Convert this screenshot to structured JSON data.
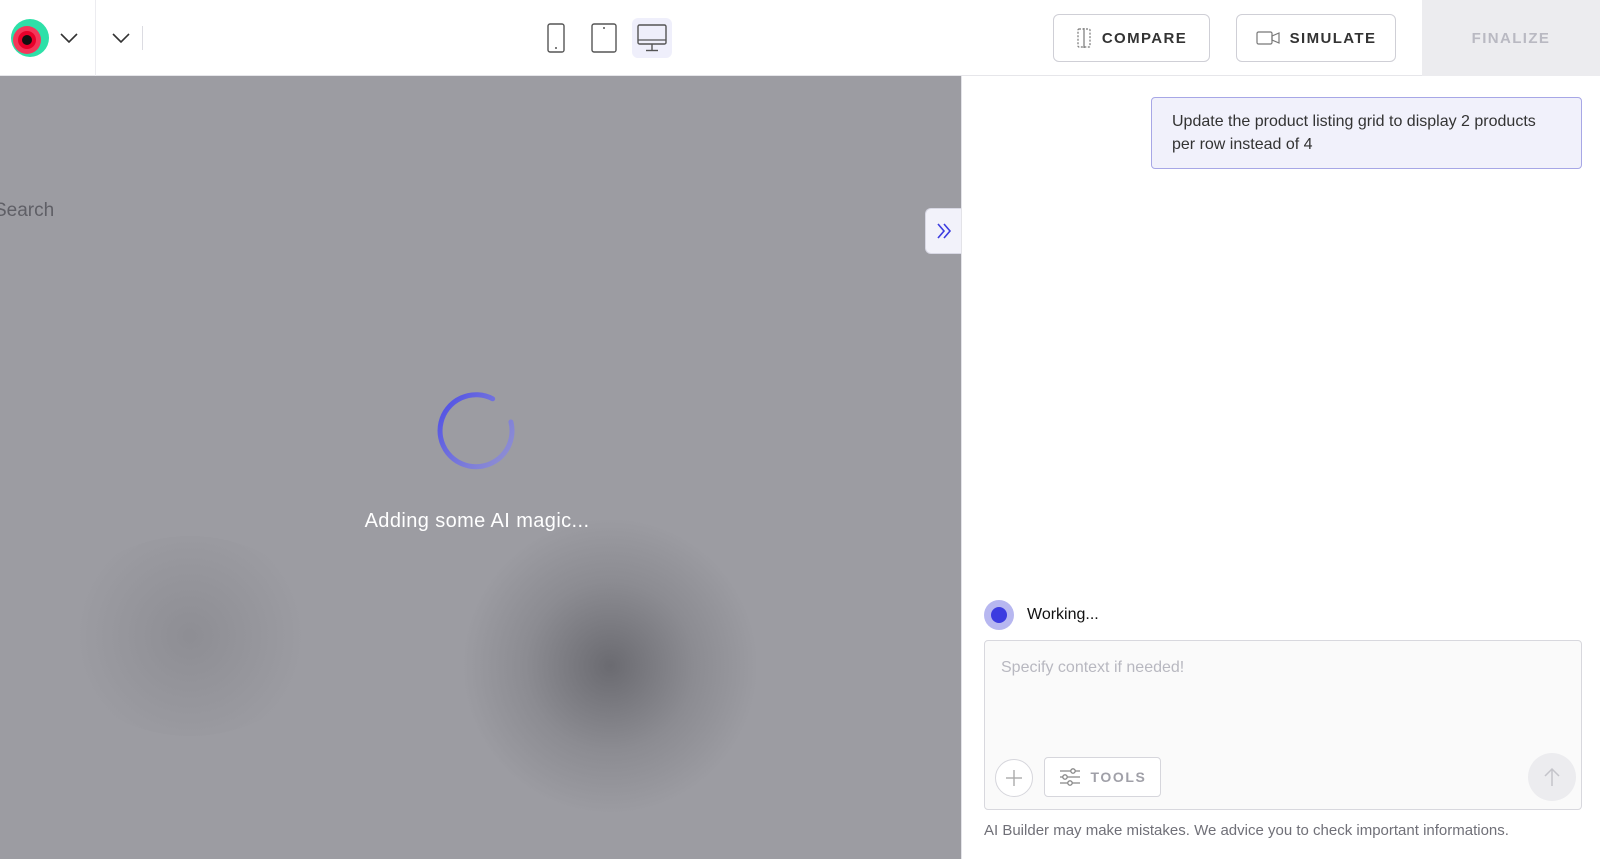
{
  "topbar": {
    "compare_label": "COMPARE",
    "simulate_label": "SIMULATE",
    "finalize_label": "FINALIZE",
    "devices": [
      "mobile",
      "tablet",
      "desktop"
    ],
    "active_device": "desktop"
  },
  "preview": {
    "search_text": "Search",
    "loading_text": "Adding some AI magic..."
  },
  "chat": {
    "user_message": "Update the product listing grid to display 2 products per row instead of 4",
    "status_text": "Working...",
    "input_placeholder": "Specify context if needed!",
    "tools_label": "TOOLS",
    "disclaimer": "AI Builder may make mistakes. We advice you to check important informations."
  },
  "colors": {
    "accent": "#3c3ce0",
    "preview_overlay": "#9c9ca2",
    "user_bubble_bg": "#f1f1fb",
    "user_bubble_border": "#a7a7e6"
  }
}
